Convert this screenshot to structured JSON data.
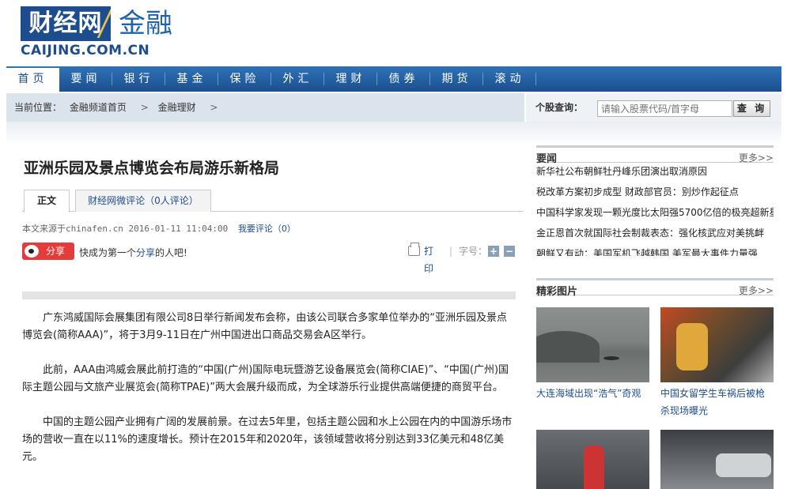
{
  "brand": {
    "logo_text": "财经网",
    "channel": "金融",
    "domain": "CAIJING.COM.CN"
  },
  "nav": {
    "items": [
      "首页",
      "要闻",
      "银行",
      "基金",
      "保险",
      "外汇",
      "理财",
      "债券",
      "期货",
      "滚动"
    ],
    "active_index": 0
  },
  "breadcrumb": {
    "prefix": "当前位置：",
    "items": [
      "金融频道首页",
      "金融理财"
    ],
    "sep": ">"
  },
  "stock_search": {
    "label": "个股查询：",
    "placeholder": "请输入股票代码/首字母",
    "button": "查 询"
  },
  "article": {
    "title": "亚洲乐园及景点博览会布局游乐新格局",
    "tabs": [
      "正文",
      "财经网微评论（0人评论）"
    ],
    "meta": "本文来源于chinafen.cn  2016-01-11 11:04:00",
    "comment_link": "我要评论（0）",
    "share_label": "分享",
    "share_prompt_pre": "快成为第一个",
    "share_prompt_link": "分享",
    "share_prompt_post": "的人吧!",
    "print_label": "打印",
    "font_label": "字号：",
    "font_plus": "+",
    "font_minus": "−",
    "paragraphs": [
      "广东鸿威国际会展集团有限公司8日举行新闻发布会称，由该公司联合多家单位举办的“亚洲乐园及景点博览会(简称AAA)”，将于3月9-11日在广州中国进出口商品交易会A区举行。",
      "此前，AAA由鸿威会展此前打造的“中国(广州)国际电玩暨游艺设备展览会(简称CIAE)”、“中国(广州)国际主题公园与文旅产业展览会(简称TPAE)”两大会展升级而成，为全球游乐行业提供高端便捷的商贸平台。",
      "中国的主题公园产业拥有广阔的发展前景。在过去5年里，包括主题公园和水上公园在内的中国游乐场市场的营收一直在以11%的速度增长。预计在2015年和2020年，该领域营收将分别达到33亿美元和48亿美元。"
    ]
  },
  "sidebar": {
    "news": {
      "title": "要闻",
      "more": "更多>>",
      "items": [
        "新华社公布朝鲜牡丹峰乐团演出取消原因",
        "税改革方案初步成型 财政部官员：别炒作起征点",
        "中国科学家发现一颗光度比太阳强5700亿倍的极亮超新星",
        "金正恩首次就国际社会制裁表态：强化核武应对美挑衅",
        "朝鲜又有动：美国军机飞越韩国 美军最大事件力量强"
      ]
    },
    "pictures": {
      "title": "精彩图片",
      "more": "更多>>",
      "items": [
        {
          "caption": "大连海域出现“浩气”奇观",
          "icon": "photo-sea"
        },
        {
          "caption": "中国女留学生车祸后被枪杀现场曝光",
          "icon": "photo-accident"
        },
        {
          "caption": "",
          "icon": "photo-crowd"
        },
        {
          "caption": "",
          "icon": "photo-car"
        }
      ]
    }
  }
}
